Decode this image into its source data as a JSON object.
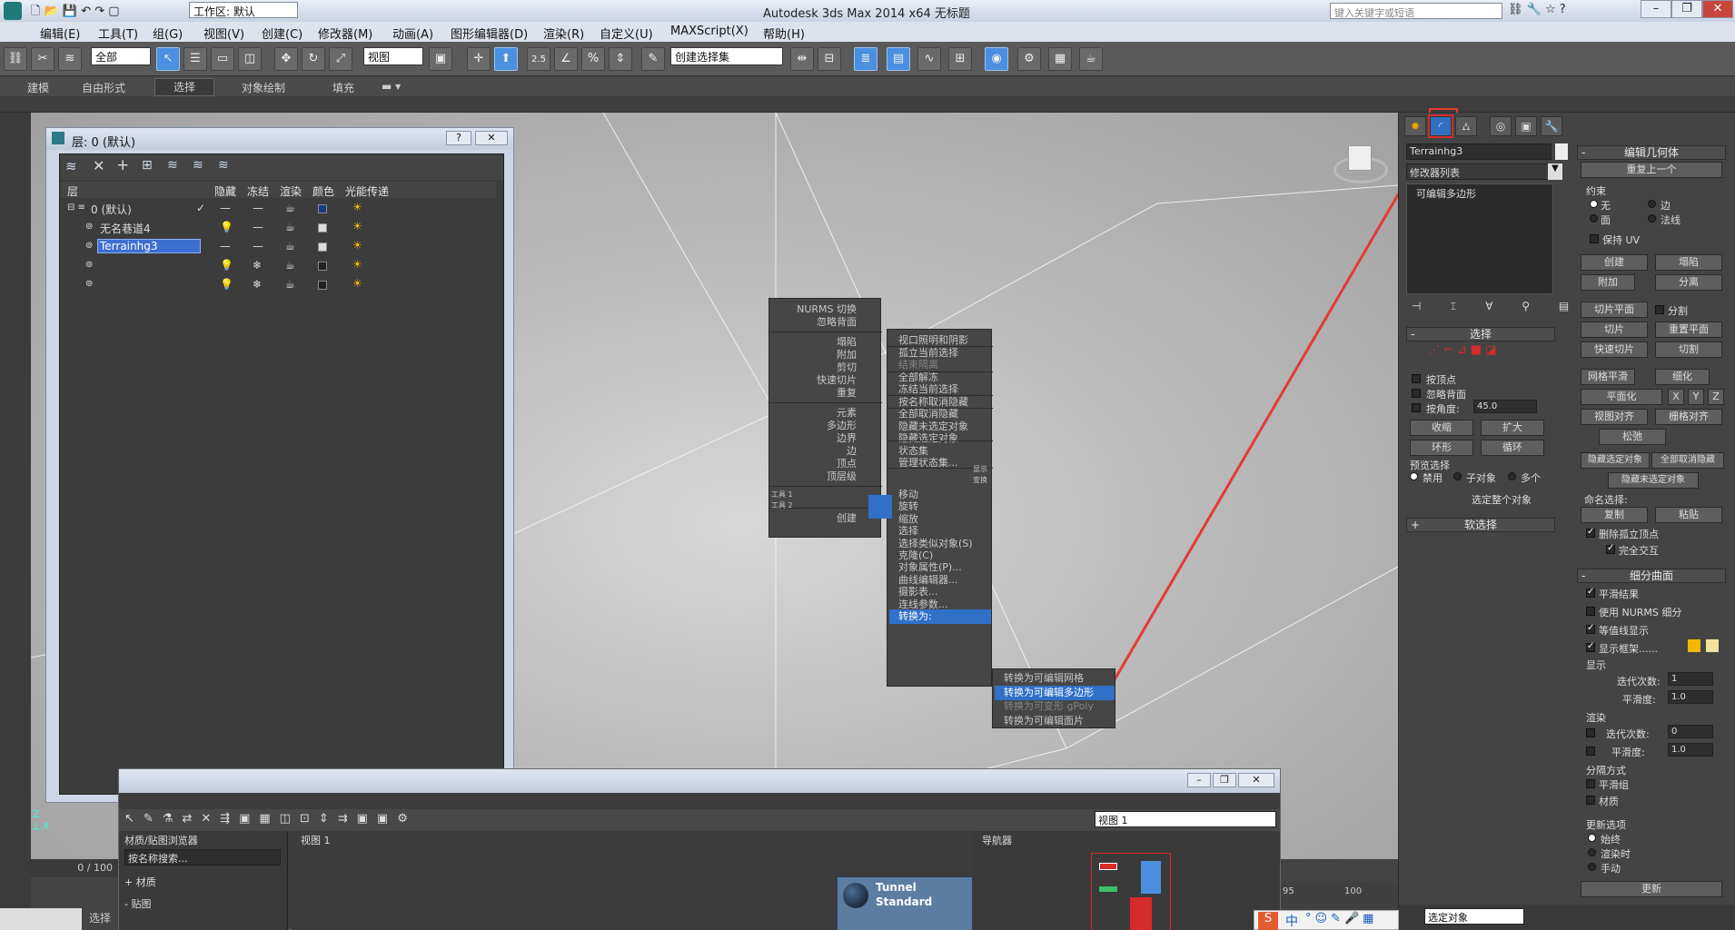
{
  "window": {
    "title": "Autodesk 3ds Max  2014 x64     无标题",
    "workspace": "工作区: 默认",
    "search_placeholder": "键入关键字或短语"
  },
  "menu": [
    "编辑(E)",
    "工具(T)",
    "组(G)",
    "视图(V)",
    "创建(C)",
    "修改器(M)",
    "动画(A)",
    "图形编辑器(D)",
    "渲染(R)",
    "自定义(U)",
    "MAXScript(X)",
    "帮助(H)"
  ],
  "toolbar": {
    "selection_filter": "全部",
    "ref_coord": "视图",
    "snap_value": "2.5",
    "named_selection": "创建选择集"
  },
  "ribbon_tabs": [
    "建模",
    "自由形式",
    "选择",
    "对象绘制",
    "填充"
  ],
  "layer_window": {
    "title": "层: 0 (默认)",
    "headers": [
      "层",
      "隐藏",
      "冻结",
      "渲染",
      "颜色",
      "光能传递"
    ],
    "rows": [
      {
        "name": "0 (默认)",
        "color": "#1a3a8a"
      },
      {
        "name": "无名巷道4",
        "color": "#dddddd"
      },
      {
        "name": "Terrainhg3",
        "color": "#dddddd"
      },
      {
        "name": "",
        "color": "#222222"
      },
      {
        "name": "",
        "color": "#222222"
      }
    ]
  },
  "quad_menu_left": {
    "items": [
      "NURMS 切换",
      "忽略背面",
      "塌陷",
      "附加",
      "剪切",
      "快速切片",
      "重复",
      "元素",
      "多边形",
      "边界",
      "边",
      "顶点",
      "顶层级"
    ],
    "tools1": "工具 1",
    "tools2": "工具 2",
    "display": "显示",
    "transform": "变换",
    "create": "创建"
  },
  "quad_menu_right": {
    "items": [
      "视口照明和阴影",
      "孤立当前选择",
      "结束隔离",
      "全部解冻",
      "冻结当前选择",
      "按名称取消隐藏",
      "全部取消隐藏",
      "隐藏未选定对象",
      "隐藏选定对象",
      "状态集",
      "管理状态集...",
      "移动",
      "旋转",
      "缩放",
      "选择",
      "选择类似对象(S)",
      "克隆(C)",
      "对象属性(P)...",
      "曲线编辑器...",
      "摄影表...",
      "连线参数...",
      "转换为:"
    ]
  },
  "submenu": [
    "转换为可编辑网格",
    "转换为可编辑多边形",
    "转换为可变形 gPoly",
    "转换为可编辑面片"
  ],
  "command_panel": {
    "object_name": "Terrainhg3",
    "modifier_list": "修改器列表",
    "stack_item": "可编辑多边形",
    "selection_title": "选择",
    "by_vertex": "按顶点",
    "ignore_backfacing": "忽略背面",
    "by_angle": "按角度:",
    "angle_value": "45.0",
    "shrink": "收缩",
    "grow": "扩大",
    "ring": "环形",
    "loop": "循环",
    "preview_selection": "预览选择",
    "preview_options": [
      "禁用",
      "子对象",
      "多个"
    ],
    "whole_object": "选定整个对象",
    "soft_selection": "软选择",
    "edit_geometry": "编辑几何体",
    "repeat_last": "重复上一个",
    "constraints": "约束",
    "constraint_options": [
      "无",
      "边",
      "面",
      "法线"
    ],
    "preserve_uv": "保持 UV",
    "create": "创建",
    "collapse": "塌陷",
    "attach": "附加",
    "detach": "分离",
    "slice_plane": "切片平面",
    "split": "分割",
    "slice": "切片",
    "reset_plane": "重置平面",
    "quickslice": "快速切片",
    "cut": "切割",
    "meshsmooth": "网格平滑",
    "tessellate": "细化",
    "planarize": "平面化",
    "xyz": [
      "X",
      "Y",
      "Z"
    ],
    "view_align": "视图对齐",
    "grid_align": "栅格对齐",
    "relax": "松弛",
    "hide_selected": "隐藏选定对象",
    "unhide_all": "全部取消隐藏",
    "hide_unselected": "隐藏未选定对象",
    "named_selections": "命名选择:",
    "copy": "复制",
    "paste": "粘贴",
    "delete_isolated": "删除孤立顶点",
    "full_interactivity": "完全交互",
    "subdivision_surface": "细分曲面",
    "smooth_result": "平滑结果",
    "use_nurms": "使用 NURMS 细分",
    "isoline_display": "等值线显示",
    "show_cage": "显示框架......",
    "display": "显示",
    "iterations": "迭代次数:",
    "iterations_value": "1",
    "smoothness": "平滑度:",
    "smoothness_value": "1.0",
    "render": "渲染",
    "render_iter_value": "0",
    "separate_by": "分隔方式",
    "smoothing_groups": "平滑组",
    "materials": "材质",
    "update_options": "更新选项",
    "always": "始终",
    "when_rendering": "渲染时",
    "manually": "手动",
    "update": "更新",
    "cage_color_1": "#f5b800",
    "cage_color_2": "#f2e39a"
  },
  "bottom_window": {
    "browser_title": "材质/贴图浏览器",
    "search_placeholder": "按名称搜索...",
    "materials": "+ 材质",
    "maps": "- 贴图",
    "view_title": "视图 1",
    "view_dropdown": "视图 1",
    "navigator": "导航器",
    "node_name": "Tunnel",
    "node_type": "Standard"
  },
  "status": {
    "frame": "0 / 100",
    "select_object": "选定对象",
    "ruler_95": "95",
    "ruler_100": "100",
    "select_label": "选择"
  },
  "ime": "中"
}
